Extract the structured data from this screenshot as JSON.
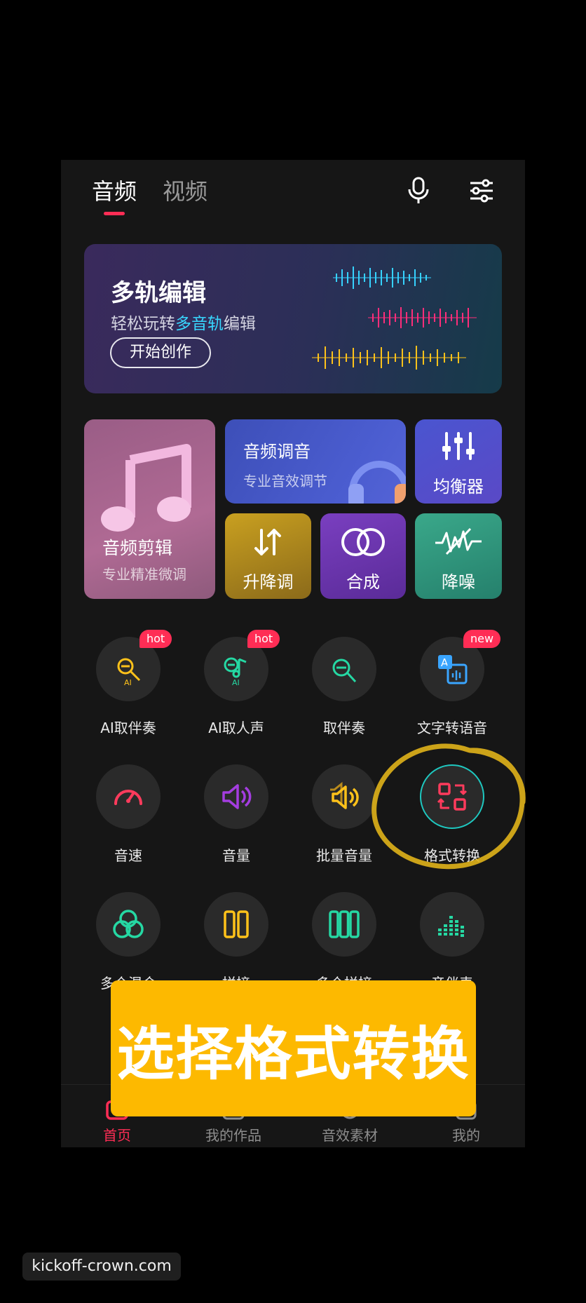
{
  "header": {
    "tabs": [
      {
        "label": "音频",
        "active": true
      },
      {
        "label": "视频",
        "active": false
      }
    ],
    "icons": [
      "microphone-icon",
      "settings-sliders-icon"
    ]
  },
  "hero": {
    "title": "多轨编辑",
    "subtitle_prefix": "轻松玩转",
    "subtitle_highlight": "多音轨",
    "subtitle_suffix": "编辑",
    "button_label": "开始创作"
  },
  "cards": {
    "audio_edit": {
      "label": "音频剪辑",
      "sub": "专业精准微调"
    },
    "audio_tune": {
      "label": "音频调音",
      "sub": "专业音效调节"
    },
    "equalizer": {
      "label": "均衡器"
    },
    "pitch": {
      "label": "升降调"
    },
    "merge": {
      "label": "合成"
    },
    "denoise": {
      "label": "降噪"
    }
  },
  "tools": [
    {
      "label": "AI取伴奏",
      "badge": "hot",
      "icon": "ai-accompaniment-icon"
    },
    {
      "label": "AI取人声",
      "badge": "hot",
      "icon": "ai-vocal-icon"
    },
    {
      "label": "取伴奏",
      "badge": "",
      "icon": "accompaniment-icon"
    },
    {
      "label": "文字转语音",
      "badge": "new",
      "icon": "text-to-speech-icon"
    },
    {
      "label": "音速",
      "badge": "",
      "icon": "speedometer-icon"
    },
    {
      "label": "音量",
      "badge": "",
      "icon": "volume-icon"
    },
    {
      "label": "批量音量",
      "badge": "",
      "icon": "batch-volume-icon"
    },
    {
      "label": "格式转换",
      "badge": "",
      "icon": "format-convert-icon"
    },
    {
      "label": "多个混合",
      "badge": "",
      "icon": "mix-icon"
    },
    {
      "label": "拼接",
      "badge": "",
      "icon": "splice-icon"
    },
    {
      "label": "多个拼接",
      "badge": "",
      "icon": "multi-splice-icon"
    },
    {
      "label": "音伴表",
      "badge": "",
      "icon": "spectrum-icon"
    }
  ],
  "bottom_nav": [
    {
      "label": "首页",
      "active": true
    },
    {
      "label": "我的作品",
      "active": false
    },
    {
      "label": "音效素材",
      "active": false
    },
    {
      "label": "我的",
      "active": false
    }
  ],
  "overlay": {
    "text": "选择格式转换"
  },
  "watermark": "kickoff-crown.com",
  "colors": {
    "accent": "#ff2d55",
    "overlay": "#fdb900",
    "highlight": "#38d7ff"
  }
}
